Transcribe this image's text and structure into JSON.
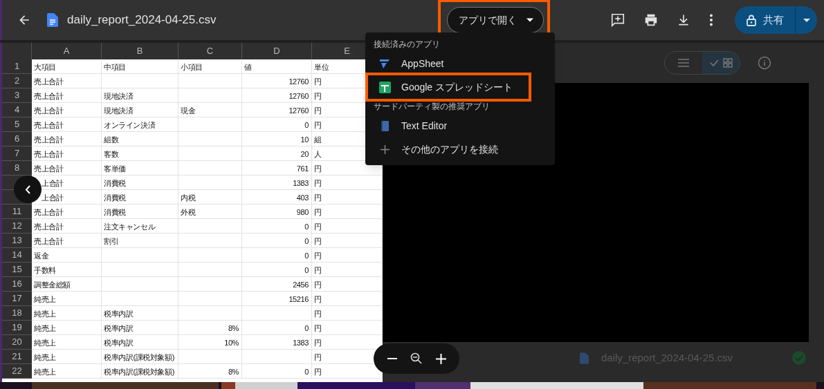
{
  "header": {
    "filename": "daily_report_2024-04-25.csv",
    "open_with": {
      "label": "アプリで開く",
      "highlighted": true
    },
    "share": {
      "label": "共有"
    }
  },
  "open_with_menu": {
    "sections": [
      {
        "heading": "接続済みのアプリ",
        "items": [
          {
            "kind": "appsheet",
            "label": "AppSheet",
            "highlighted": false
          },
          {
            "kind": "sheets",
            "label": "Google スプレッドシート",
            "highlighted": true
          }
        ]
      },
      {
        "heading": "サードパーティ製の推奨アプリ",
        "items": [
          {
            "kind": "texteditor",
            "label": "Text Editor",
            "highlighted": false
          },
          {
            "kind": "connect",
            "label": "その他のアプリを接続",
            "highlighted": false
          }
        ]
      }
    ]
  },
  "sheet": {
    "columns": [
      "A",
      "B",
      "C",
      "D",
      "E"
    ],
    "rows": [
      {
        "number": "1",
        "cells": [
          "大項目",
          "中項目",
          "小項目",
          "値",
          "単位"
        ]
      },
      {
        "number": "2",
        "cells": [
          "売上合計",
          null,
          null,
          "12760",
          "円"
        ]
      },
      {
        "number": "3",
        "cells": [
          "売上合計",
          "現地決済",
          null,
          "12760",
          "円"
        ]
      },
      {
        "number": "4",
        "cells": [
          "売上合計",
          "現地決済",
          "現金",
          "12760",
          "円"
        ]
      },
      {
        "number": "5",
        "cells": [
          "売上合計",
          "オンライン決済",
          null,
          "0",
          "円"
        ]
      },
      {
        "number": "6",
        "cells": [
          "売上合計",
          "組数",
          null,
          "10",
          "組"
        ]
      },
      {
        "number": "7",
        "cells": [
          "売上合計",
          "客数",
          null,
          "20",
          "人"
        ]
      },
      {
        "number": "8",
        "cells": [
          "売上合計",
          "客単価",
          null,
          "761",
          "円"
        ]
      },
      {
        "number": null,
        "cells": [
          "上合計",
          "消費税",
          null,
          "1383",
          "円"
        ]
      },
      {
        "number": null,
        "cells": [
          "上合計",
          "消費税",
          "内税",
          "403",
          "円"
        ]
      },
      {
        "number": "11",
        "cells": [
          "売上合計",
          "消費税",
          "外税",
          "980",
          "円"
        ]
      },
      {
        "number": "12",
        "cells": [
          "売上合計",
          "注文キャンセル",
          null,
          "0",
          "円"
        ]
      },
      {
        "number": "13",
        "cells": [
          "売上合計",
          "割引",
          null,
          "0",
          "円"
        ]
      },
      {
        "number": "14",
        "cells": [
          "返金",
          null,
          null,
          "0",
          "円"
        ]
      },
      {
        "number": "15",
        "cells": [
          "手数料",
          null,
          null,
          "0",
          "円"
        ]
      },
      {
        "number": "16",
        "cells": [
          "調整金総額",
          null,
          null,
          "2456",
          "円"
        ]
      },
      {
        "number": "17",
        "cells": [
          "純売上",
          null,
          null,
          "15216",
          "円"
        ]
      },
      {
        "number": "18",
        "cells": [
          "純売上",
          "税率内訳",
          null,
          null,
          "円"
        ]
      },
      {
        "number": "19",
        "cells": [
          "純売上",
          "税率内訳",
          "8%",
          "0",
          "円"
        ]
      },
      {
        "number": "20",
        "cells": [
          "純売上",
          "税率内訳",
          "10%",
          "1383",
          "円"
        ]
      },
      {
        "number": "21",
        "cells": [
          "純売上",
          "税率内訳(課税対象額)",
          null,
          null,
          "円"
        ]
      },
      {
        "number": "22",
        "cells": [
          "純売上",
          "税率内訳(課税対象額)",
          "8%",
          "0",
          "円"
        ]
      }
    ]
  },
  "background": {
    "view_toggle": [
      {
        "kind": "list",
        "selected": false
      },
      {
        "kind": "grid",
        "selected": true
      }
    ],
    "file_row": {
      "name": "daily_report_2024-04-25.csv"
    }
  }
}
